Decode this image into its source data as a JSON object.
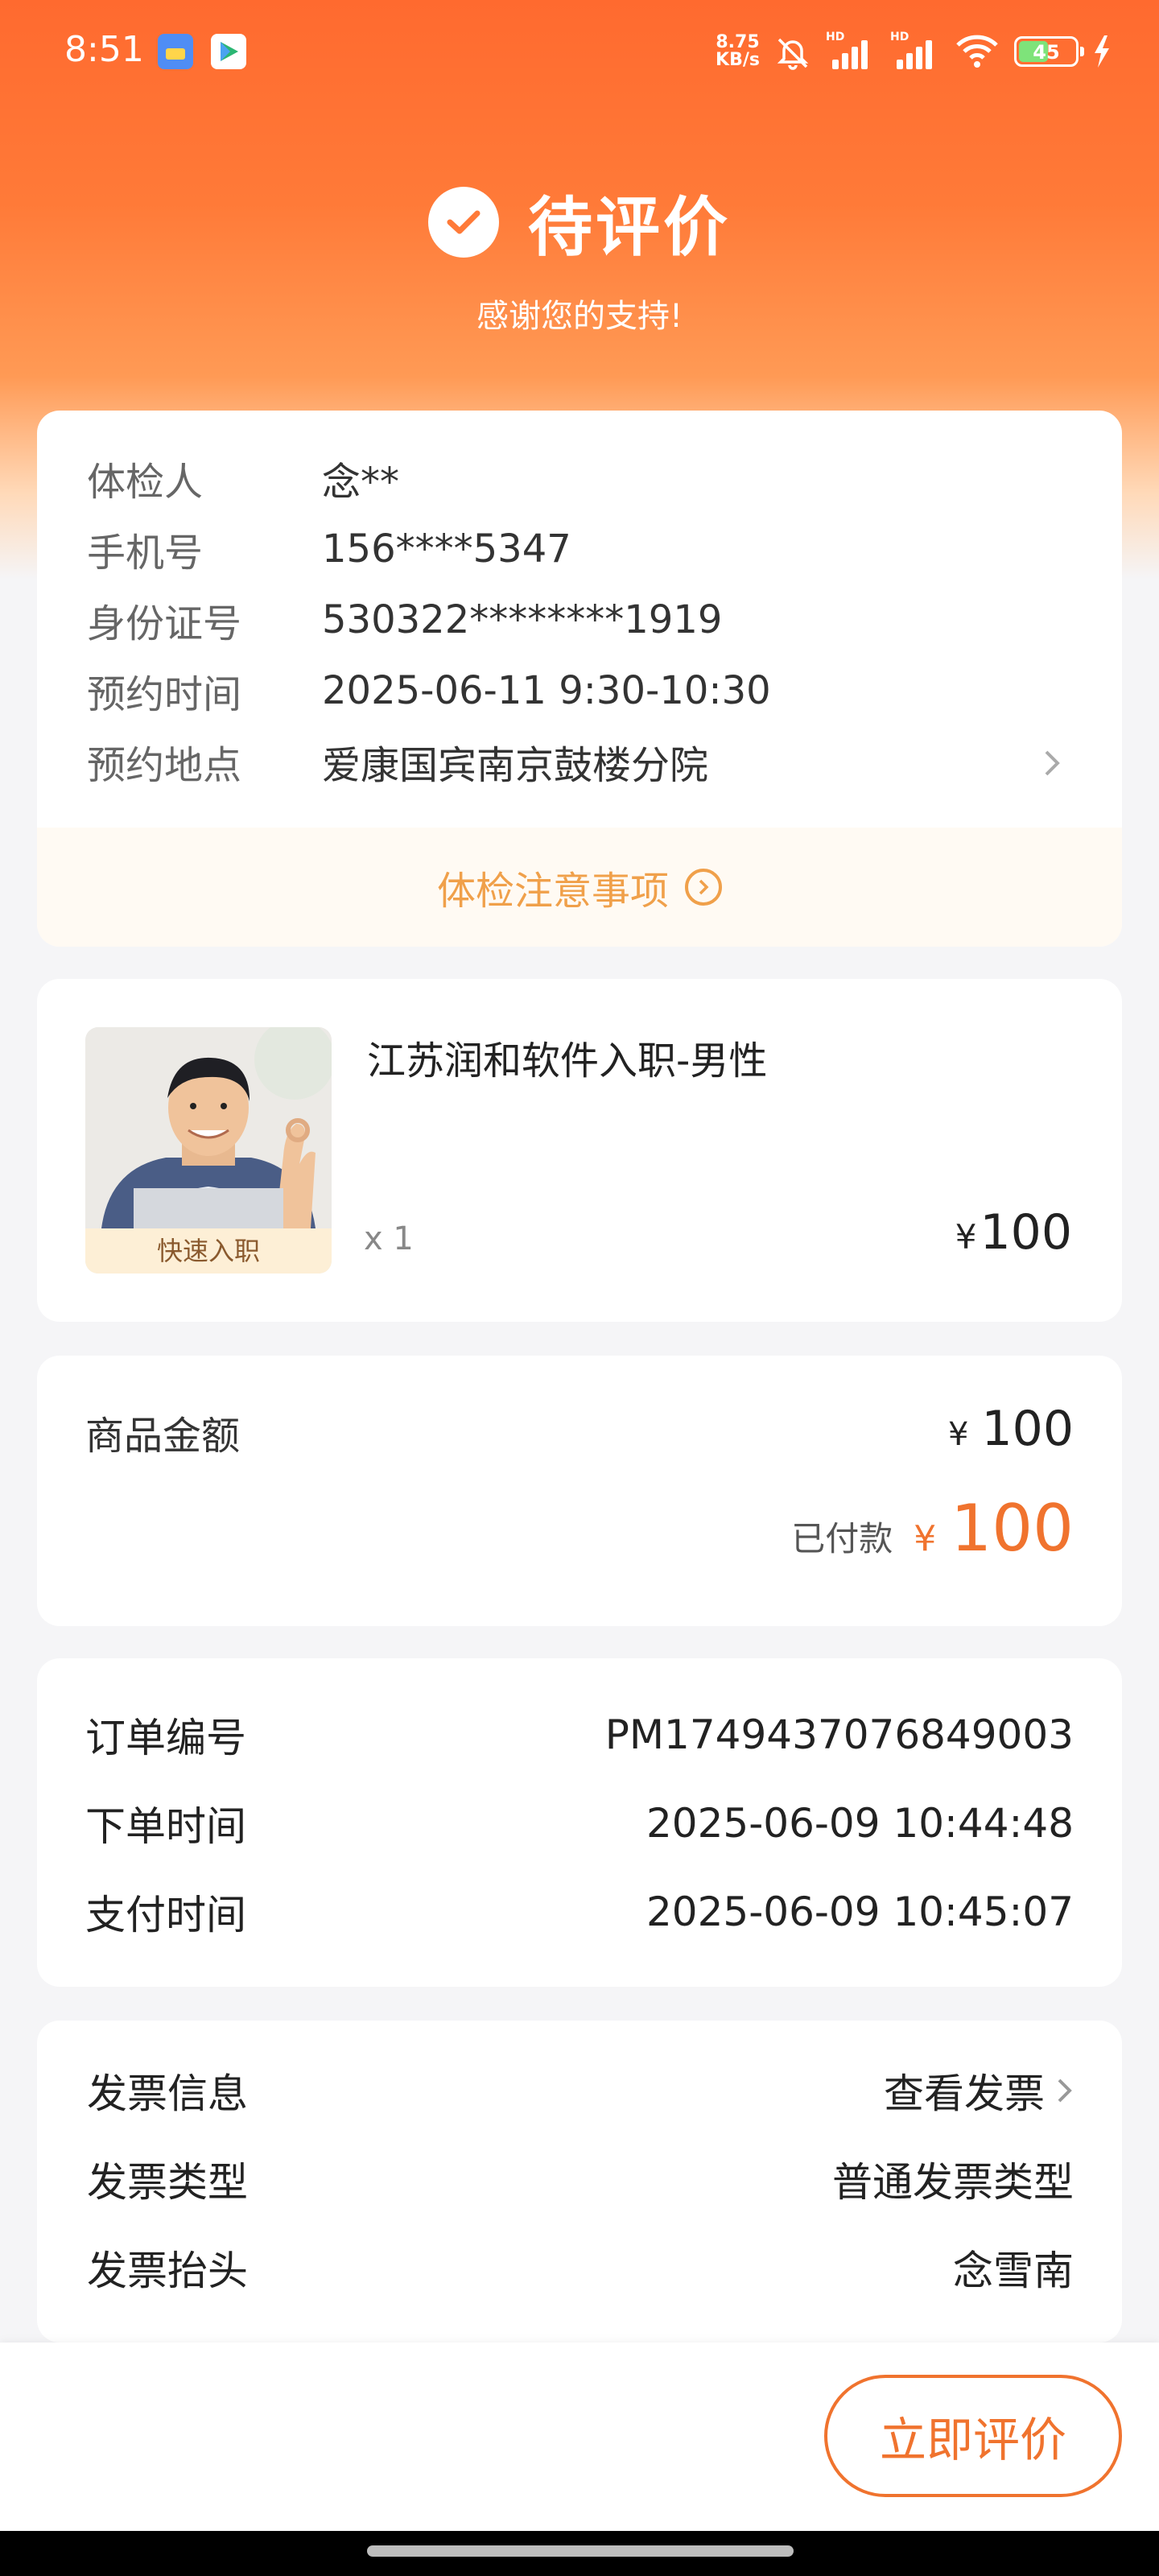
{
  "status_bar": {
    "time": "8:51",
    "network_speed": "8.75",
    "network_unit": "KB/s",
    "signal1_label": "HD",
    "signal2_label": "HD",
    "battery": "45",
    "icons": [
      "gallery-app-icon",
      "play-app-icon",
      "mute-bell-icon",
      "signal-icon",
      "signal-icon",
      "wifi-icon",
      "battery-icon",
      "charging-icon"
    ]
  },
  "header": {
    "status": "待评价",
    "subtitle": "感谢您的支持!"
  },
  "exam_info": {
    "rows": [
      {
        "label": "体检人",
        "value": "念**"
      },
      {
        "label": "手机号",
        "value": "156****5347"
      },
      {
        "label": "身份证号",
        "value": "530322********1919"
      },
      {
        "label": "预约时间",
        "value": "2025-06-11 9:30-10:30"
      },
      {
        "label": "预约地点",
        "value": "爱康国宾南京鼓楼分院"
      }
    ],
    "notice_link": "体检注意事项"
  },
  "product": {
    "name": "江苏润和软件入职-男性",
    "image_tag": "快速入职",
    "quantity": "x 1",
    "currency": "¥",
    "price": "100"
  },
  "amount": {
    "label": "商品金额",
    "currency": "¥",
    "value": "100",
    "paid_label": "已付款",
    "paid_currency": "¥",
    "paid_value": "100"
  },
  "order": {
    "rows": [
      {
        "label": "订单编号",
        "value": "PM1749437076849003"
      },
      {
        "label": "下单时间",
        "value": "2025-06-09 10:44:48"
      },
      {
        "label": "支付时间",
        "value": "2025-06-09 10:45:07"
      }
    ]
  },
  "invoice": {
    "info_label": "发票信息",
    "info_link": "查看发票",
    "type_label": "发票类型",
    "type_value": "普通发票类型",
    "title_label": "发票抬头",
    "title_value": "念雪南"
  },
  "footer": {
    "review_button": "立即评价"
  },
  "colors": {
    "accent": "#f0732e",
    "header_gradient_top": "#ff6a2f",
    "notice": "#f0a04a"
  }
}
